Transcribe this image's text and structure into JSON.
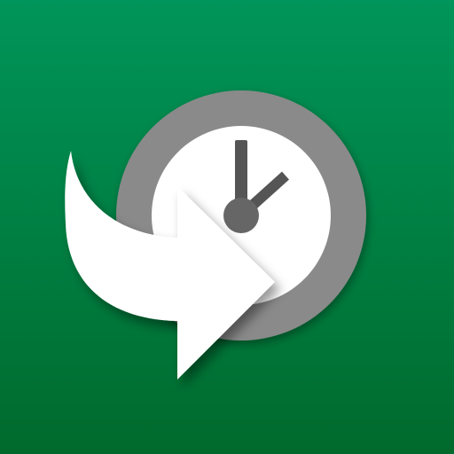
{
  "app_icon": {
    "icon": "clock-with-forward-arrow-icon",
    "clock": {
      "icon": "clock-icon",
      "hour_hand_icon": "clock-hour-hand-icon",
      "minute_hand_icon": "clock-minute-hand-icon"
    },
    "arrow": {
      "icon": "forward-arrow-icon"
    },
    "colors": {
      "background_top": "#00955a",
      "background_bottom": "#006a2c",
      "clock_ring": "#8a8a8a",
      "clock_face": "#ffffff",
      "clock_hands": "#555555",
      "arrow": "#ffffff"
    }
  }
}
